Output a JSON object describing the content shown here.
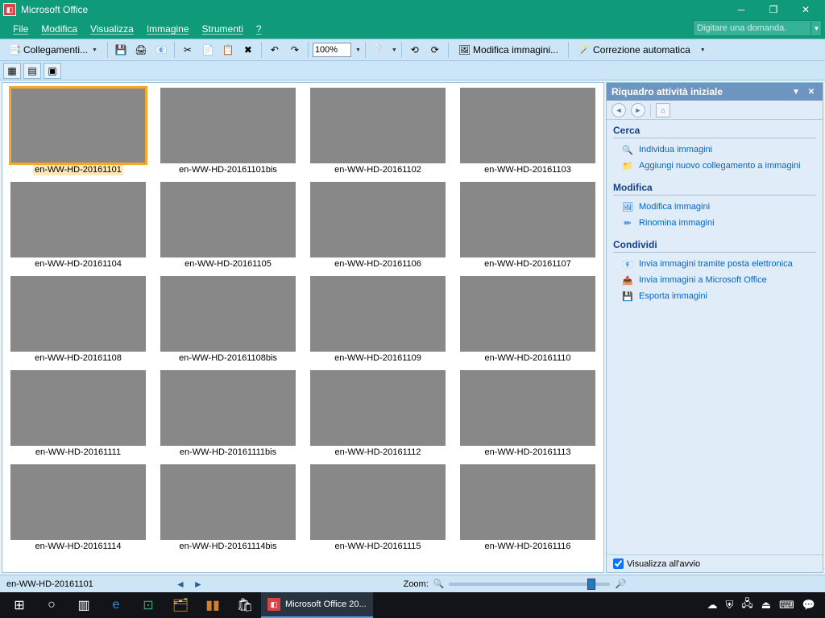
{
  "titlebar": {
    "title": "Microsoft Office"
  },
  "menubar": {
    "items": [
      "File",
      "Modifica",
      "Visualizza",
      "Immagine",
      "Strumenti",
      "?"
    ],
    "help_placeholder": "Digitare una domanda."
  },
  "toolbar": {
    "shortcuts_label": "Collegamenti...",
    "zoom_value": "100%",
    "edit_images_label": "Modifica immagini...",
    "autocorrect_label": "Correzione automatica"
  },
  "gallery": {
    "thumbs": [
      {
        "name": "en-WW-HD-20161101",
        "bg": "bg0",
        "selected": true
      },
      {
        "name": "en-WW-HD-20161101bis",
        "bg": "bg1"
      },
      {
        "name": "en-WW-HD-20161102",
        "bg": "bg2"
      },
      {
        "name": "en-WW-HD-20161103",
        "bg": "bg3"
      },
      {
        "name": "en-WW-HD-20161104",
        "bg": "bg4"
      },
      {
        "name": "en-WW-HD-20161105",
        "bg": "bg5"
      },
      {
        "name": "en-WW-HD-20161106",
        "bg": "bg6"
      },
      {
        "name": "en-WW-HD-20161107",
        "bg": "bg7"
      },
      {
        "name": "en-WW-HD-20161108",
        "bg": "bg8"
      },
      {
        "name": "en-WW-HD-20161108bis",
        "bg": "bg9"
      },
      {
        "name": "en-WW-HD-20161109",
        "bg": "bg10"
      },
      {
        "name": "en-WW-HD-20161110",
        "bg": "bg11"
      },
      {
        "name": "en-WW-HD-20161111",
        "bg": "bg12"
      },
      {
        "name": "en-WW-HD-20161111bis",
        "bg": "bg13"
      },
      {
        "name": "en-WW-HD-20161112",
        "bg": "bg14"
      },
      {
        "name": "en-WW-HD-20161113",
        "bg": "bg15"
      },
      {
        "name": "en-WW-HD-20161114",
        "bg": "bg16"
      },
      {
        "name": "en-WW-HD-20161114bis",
        "bg": "bg17"
      },
      {
        "name": "en-WW-HD-20161115",
        "bg": "bg18"
      },
      {
        "name": "en-WW-HD-20161116",
        "bg": "bg19"
      }
    ]
  },
  "taskpane": {
    "title": "Riquadro attività iniziale",
    "sections": [
      {
        "title": "Cerca",
        "links": [
          {
            "label": "Individua immagini",
            "icon": "🔍"
          },
          {
            "label": "Aggiungi nuovo collegamento a immagini",
            "icon": "📁"
          }
        ]
      },
      {
        "title": "Modifica",
        "links": [
          {
            "label": "Modifica immagini",
            "icon": "🖼"
          },
          {
            "label": "Rinomina immagini",
            "icon": "✏"
          }
        ]
      },
      {
        "title": "Condividi",
        "links": [
          {
            "label": "Invia immagini tramite posta elettronica",
            "icon": "📧"
          },
          {
            "label": "Invia immagini a Microsoft Office",
            "icon": "📤"
          },
          {
            "label": "Esporta immagini",
            "icon": "💾"
          }
        ]
      }
    ],
    "footer_checkbox": "Visualizza all'avvio"
  },
  "statusbar": {
    "selected_name": "en-WW-HD-20161101",
    "zoom_label": "Zoom:"
  },
  "taskbar": {
    "app_label": "Microsoft Office 20..."
  }
}
